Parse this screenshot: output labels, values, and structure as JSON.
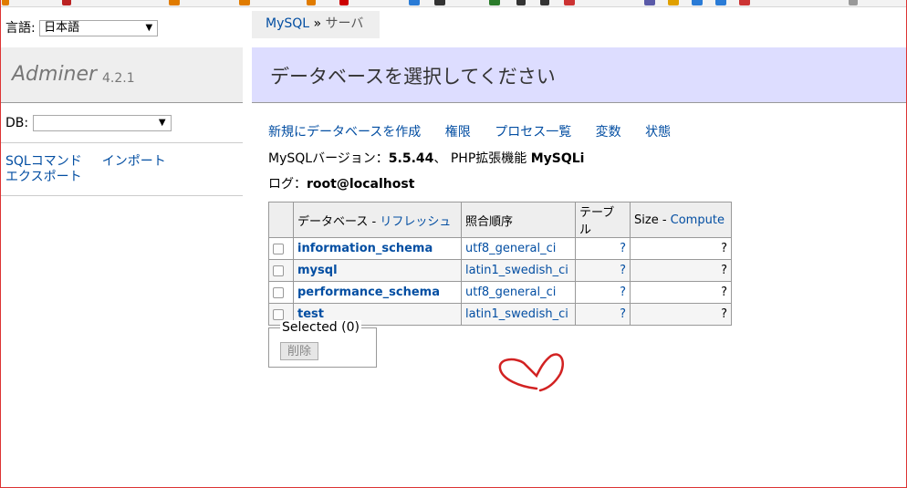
{
  "sidebar": {
    "lang_label": "言語:",
    "lang_value": "日本語",
    "logo_name": "Adminer",
    "logo_version": "4.2.1",
    "db_label": "DB:",
    "db_value": "",
    "commands": [
      "SQLコマンド",
      "インポート",
      "エクスポート"
    ]
  },
  "breadcrumb": {
    "item": "MySQL",
    "sep": " » ",
    "current": "サーバ"
  },
  "header": {
    "title": "データベースを選択してください"
  },
  "links": [
    "新規にデータベースを作成",
    "権限",
    "プロセス一覧",
    "変数",
    "状態"
  ],
  "version": {
    "label": "MySQLバージョン：",
    "value": "5.5.44",
    "sep": "、 PHP拡張機能 ",
    "ext": "MySQLi"
  },
  "log": {
    "label": "ログ：",
    "value": "root@localhost"
  },
  "table": {
    "headers": {
      "db": "データベース - ",
      "refresh": "リフレッシュ",
      "collation": "照合順序",
      "tables": "テーブル",
      "size": "Size - ",
      "compute": "Compute"
    },
    "rows": [
      {
        "name": "information_schema",
        "collation": "utf8_general_ci",
        "tables": "?",
        "size": "?"
      },
      {
        "name": "mysql",
        "collation": "latin1_swedish_ci",
        "tables": "?",
        "size": "?"
      },
      {
        "name": "performance_schema",
        "collation": "utf8_general_ci",
        "tables": "?",
        "size": "?"
      },
      {
        "name": "test",
        "collation": "latin1_swedish_ci",
        "tables": "?",
        "size": "?"
      }
    ]
  },
  "selected": {
    "legend": "Selected (0)",
    "delete_label": "削除"
  },
  "colors": {
    "link": "#034ea2",
    "header_bg": "#ddddff",
    "annotation": "#d22222"
  }
}
